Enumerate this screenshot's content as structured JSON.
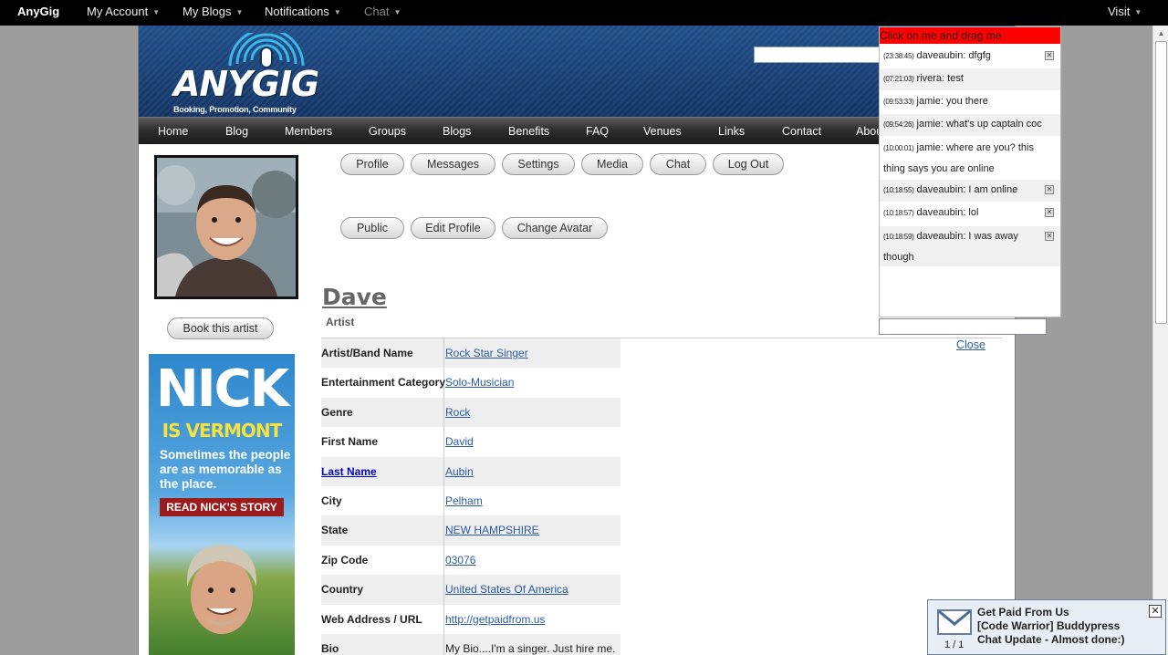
{
  "adminbar": {
    "brand": "AnyGig",
    "my_account": "My Account",
    "my_blogs": "My Blogs",
    "notifications": "Notifications",
    "chat": "Chat",
    "visit": "Visit"
  },
  "logo": {
    "wordmark": "ANYGIG",
    "tagline": "Booking, Promotion, Community"
  },
  "nav": [
    "Home",
    "Blog",
    "Members",
    "Groups",
    "Blogs",
    "Benefits",
    "FAQ",
    "Venues",
    "Links",
    "Contact",
    "Abou"
  ],
  "profile_buttons": [
    "Profile",
    "Messages",
    "Settings",
    "Media",
    "Chat",
    "Log Out"
  ],
  "edit_buttons": [
    "Public",
    "Edit Profile",
    "Change Avatar"
  ],
  "book_button": "Book this artist",
  "ad": {
    "headline": "NICK",
    "subhead": "IS VERMONT",
    "body": "Sometimes the people are as memorable as the place.",
    "cta": "READ NICK'S STORY"
  },
  "profile": {
    "name": "Dave",
    "type": "Artist",
    "close_label": "Close",
    "fields": [
      {
        "label": "Artist/Band Name",
        "value": "Rock Star Singer"
      },
      {
        "label": "Entertainment Category",
        "value": "Solo-Musician"
      },
      {
        "label": "Genre",
        "value": "Rock"
      },
      {
        "label": "First Name",
        "value": "David"
      },
      {
        "label": "Last Name",
        "value": "Aubin"
      },
      {
        "label": "City",
        "value": "Pelham"
      },
      {
        "label": "State",
        "value": "NEW HAMPSHIRE"
      },
      {
        "label": "Zip Code",
        "value": "03076"
      },
      {
        "label": "Country",
        "value": "United States Of America"
      },
      {
        "label": "Web Address / URL",
        "value": "http://getpaidfrom.us"
      },
      {
        "label": "Bio",
        "value": "My Bio....I'm a singer. Just hire me."
      }
    ]
  },
  "chat": {
    "drag_label": "Click on me and drag me",
    "messages": [
      {
        "time": "(23:38:45)",
        "text": "daveaubin: dfgfg"
      },
      {
        "time": "(07:21:03)",
        "text": "rivera: test"
      },
      {
        "time": "(09:53:33)",
        "text": "jamie: you there"
      },
      {
        "time": "(09:54:26)",
        "text": "jamie: what's up captain coc"
      },
      {
        "time": "(10:00:01)",
        "text": "jamie: where are you? this",
        "text2": "thing says you are online"
      },
      {
        "time": "(10:18:55)",
        "text": "daveaubin: I am online"
      },
      {
        "time": "(10:18:57)",
        "text": "daveaubin: lol"
      },
      {
        "time": "(10:18:59)",
        "text": "daveaubin: I was away",
        "text2": "though"
      }
    ]
  },
  "notification": {
    "count": "1 / 1",
    "line1": "Get Paid From Us",
    "line2": "[Code Warrior] Buddypress",
    "line3": "Chat Update - Almost done:)"
  },
  "colors": {
    "adminbar": "#000000",
    "chat_drag_bar": "#ff0000",
    "link": "#2a5aa8"
  }
}
